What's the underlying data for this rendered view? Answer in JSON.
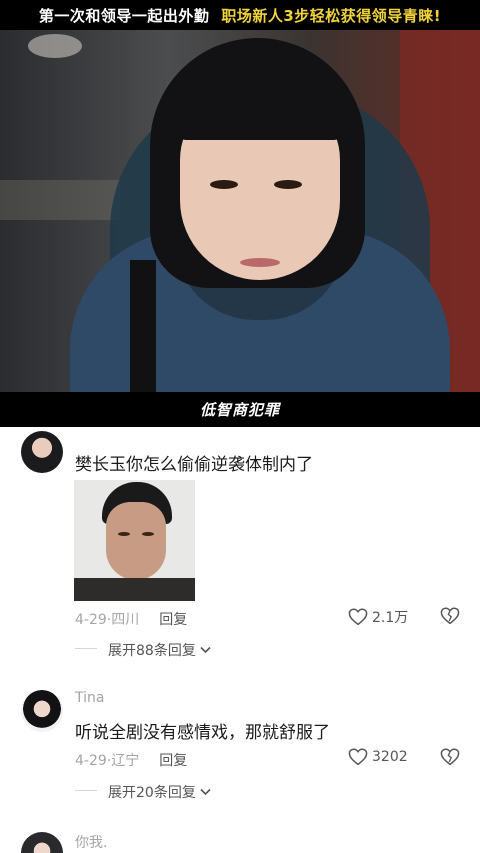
{
  "video": {
    "title_white": "第一次和领导一起出外勤",
    "title_yellow": "职场新人3步轻松获得领导青睐!",
    "watermark": "低智商犯罪"
  },
  "comments": [
    {
      "username": "",
      "text": "樊长玉你怎么偷偷逆袭体制内了",
      "date": "4-29",
      "location": "四川",
      "reply_label": "回复",
      "likes": "2.1万",
      "expand": "展开88条回复",
      "has_image": true
    },
    {
      "username": "Tina",
      "text": "听说全剧没有感情戏，那就舒服了",
      "date": "4-29",
      "location": "辽宁",
      "reply_label": "回复",
      "likes": "3202",
      "expand": "展开20条回复"
    },
    {
      "username": "你我."
    }
  ],
  "colors": {
    "banner_yellow": "#f0d33a",
    "meta_gray": "#a5a5a5"
  }
}
